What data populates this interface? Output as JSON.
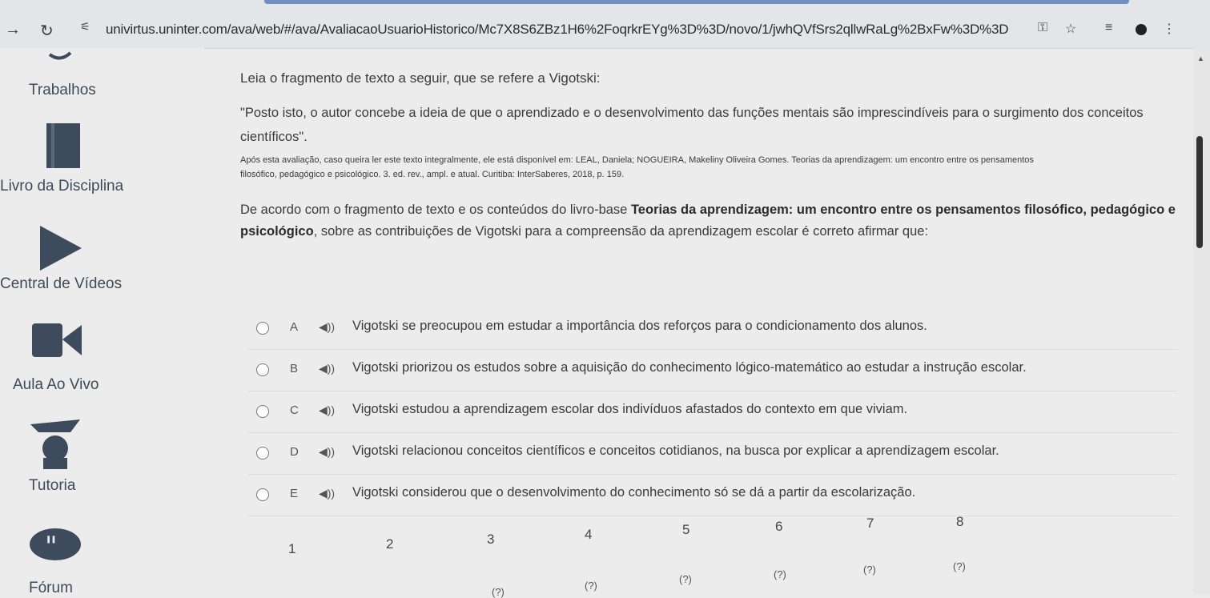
{
  "browser": {
    "url": "univirtus.uninter.com/ava/web/#/ava/AvaliacaoUsuarioHistorico/Mc7X8S6ZBz1H6%2FoqrkrEYg%3D%3D/novo/1/jwhQVfSrs2qllwRaLg%2BxFw%3D%3D"
  },
  "sidebar": {
    "items": [
      {
        "label": "Trabalhos",
        "icon": "briefcase-icon"
      },
      {
        "label": "Livro da Disciplina",
        "icon": "book-icon"
      },
      {
        "label": "Central de Vídeos",
        "icon": "play-icon"
      },
      {
        "label": "Aula Ao Vivo",
        "icon": "video-camera-icon"
      },
      {
        "label": "Tutoria",
        "icon": "graduate-icon"
      },
      {
        "label": "Fórum",
        "icon": "quote-icon"
      }
    ]
  },
  "question": {
    "intro": "Leia o fragmento de texto a seguir, que se refere a Vigotski:",
    "quote_line1": "\"Posto isto, o autor concebe a ideia de que o aprendizado e o desenvolvimento das funções mentais são imprescindíveis para o surgimento dos conceitos",
    "quote_line2": "científicos\".",
    "ref_line1": "Após esta avaliação, caso queira ler este texto integralmente, ele está disponível em: LEAL, Daniela; NOGUEIRA, Makeliny Oliveira Gomes. Teorias da aprendizagem: um encontro entre os pensamentos",
    "ref_line2": "filosófico, pedagógico e psicológico. 3. ed. rev., ampl. e atual. Curitiba: InterSaberes, 2018, p. 159.",
    "stmt_prefix": "De acordo com o fragmento de texto e os conteúdos do livro-base ",
    "stmt_book": "Teorias da aprendizagem: um encontro entre os pensamentos filosófico, pedagógico e",
    "stmt_book2": "psicológico",
    "stmt_suffix": ", sobre as contribuições de Vigotski para a compreensão da aprendizagem escolar é correto afirmar que:"
  },
  "options": [
    {
      "letter": "A",
      "text": "Vigotski se preocupou em estudar a importância dos reforços para o condicionamento dos alunos."
    },
    {
      "letter": "B",
      "text": "Vigotski priorizou os estudos sobre a aquisição do conhecimento lógico-matemático ao estudar a instrução escolar."
    },
    {
      "letter": "C",
      "text": "Vigotski estudou a aprendizagem escolar dos indivíduos afastados do contexto em que viviam."
    },
    {
      "letter": "D",
      "text": "Vigotski relacionou conceitos científicos e conceitos cotidianos, na busca por explicar a aprendizagem escolar."
    },
    {
      "letter": "E",
      "text": "Vigotski considerou que o desenvolvimento do conhecimento só se dá a partir da escolarização."
    }
  ],
  "audio_icon": "speaker-icon",
  "pagination": {
    "pages": [
      "1",
      "2",
      "3",
      "4",
      "5",
      "6",
      "7",
      "8"
    ],
    "status": [
      "(?)",
      "(?)",
      "(?)",
      "(?)",
      "(?)",
      "(?)"
    ]
  }
}
